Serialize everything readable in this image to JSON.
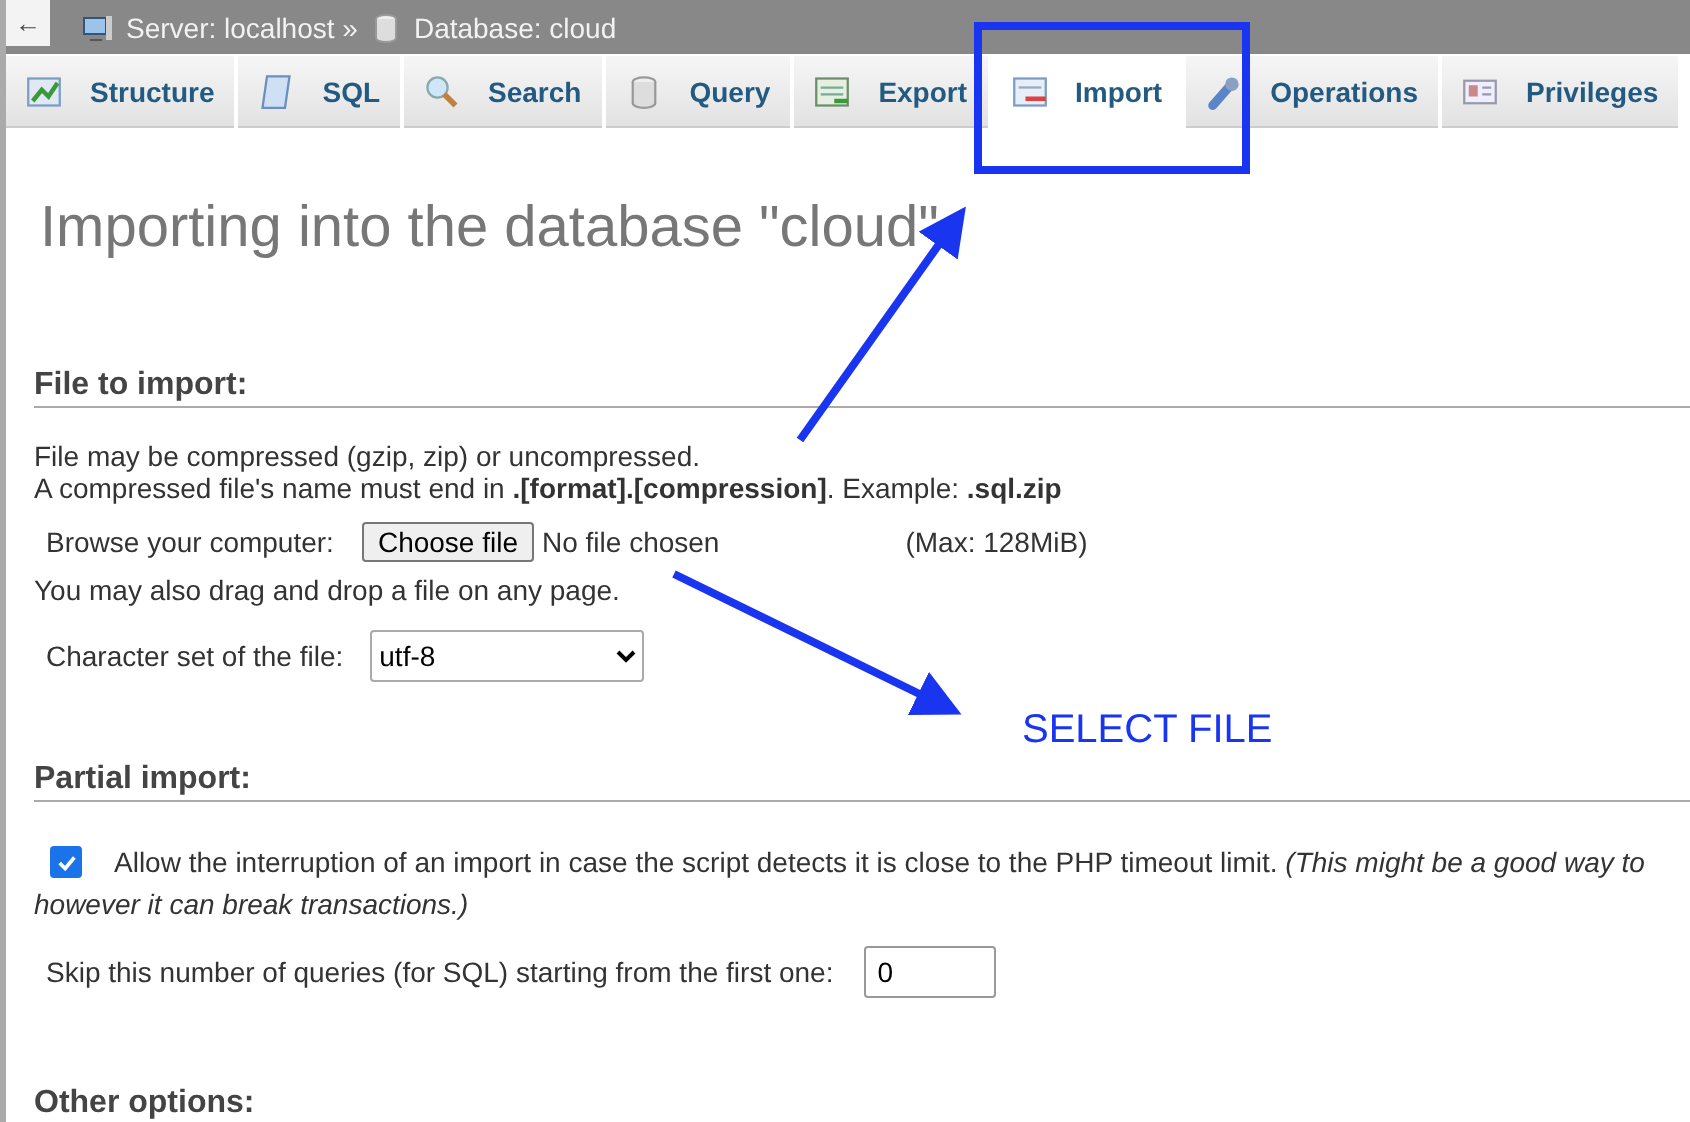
{
  "breadcrumb": {
    "back": "←",
    "server": "Server: localhost »",
    "database": "Database: cloud"
  },
  "tabs": [
    {
      "label": "Structure",
      "kind": "structure",
      "selected": false
    },
    {
      "label": "SQL",
      "kind": "sql",
      "selected": false
    },
    {
      "label": "Search",
      "kind": "search",
      "selected": false
    },
    {
      "label": "Query",
      "kind": "query",
      "selected": false
    },
    {
      "label": "Export",
      "kind": "export",
      "selected": false
    },
    {
      "label": "Import",
      "kind": "import",
      "selected": true
    },
    {
      "label": "Operations",
      "kind": "operations",
      "selected": false
    },
    {
      "label": "Privileges",
      "kind": "privileges",
      "selected": false
    }
  ],
  "title": "Importing into the database \"cloud\"",
  "file_section": {
    "heading": "File to import:",
    "note_1": "File may be compressed (gzip, zip) or uncompressed.",
    "note_2": "A compressed file's name must end in **.[format].[compression]**. Example: **.sql.zip**",
    "browse_label": "Browse your computer:",
    "choose_button": "Choose file",
    "file_status": "No file chosen",
    "max_size": "(Max: 128MiB)",
    "drag_note": "You may also drag and drop a file on any page.",
    "charset_label": "Character set of the file:",
    "charset_value": "utf-8"
  },
  "partial_section": {
    "heading": "Partial import:",
    "allow_interrupt": {
      "checked": true,
      "text": "Allow the interruption of an import in case the script detects it is close to the PHP timeout limit. *(This might be a good way to*",
      "continuation": "however it can break transactions.)"
    },
    "skip_label": "Skip this number of queries (for SQL) starting from the first one:",
    "skip_value": "0"
  },
  "other_section": {
    "heading": "Other options:"
  },
  "annotation": {
    "label": "SELECT FILE"
  }
}
